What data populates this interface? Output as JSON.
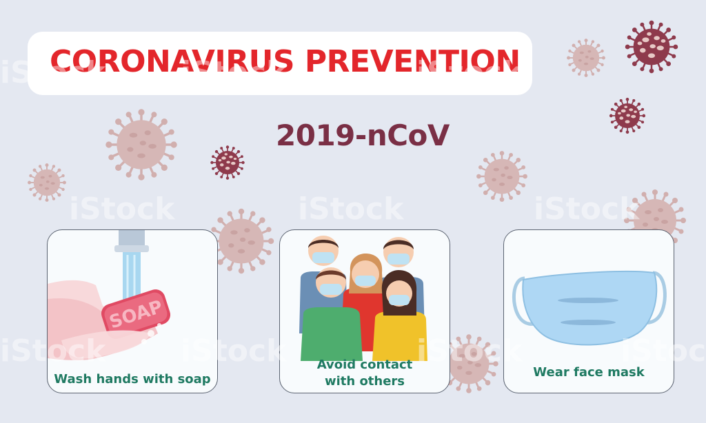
{
  "header": {
    "title": "CORONAVIRUS PREVENTION",
    "subtitle": "2019-nCoV"
  },
  "cards": [
    {
      "label": "Wash hands with soap",
      "icon": "hand-washing-icon",
      "soap_text": "SOAP"
    },
    {
      "label_line1": "Avoid contact",
      "label_line2": "with others",
      "icon": "people-with-masks-icon"
    },
    {
      "label": "Wear face mask",
      "icon": "face-mask-icon"
    }
  ],
  "watermark": {
    "text": "iStock"
  },
  "colors": {
    "background": "#e4e8f1",
    "title_red": "#e3262b",
    "subtitle_maroon": "#7a2f45",
    "label_green": "#1f7a62",
    "virus_light": "#d6b7b6",
    "virus_dark": "#8e3a4c"
  }
}
